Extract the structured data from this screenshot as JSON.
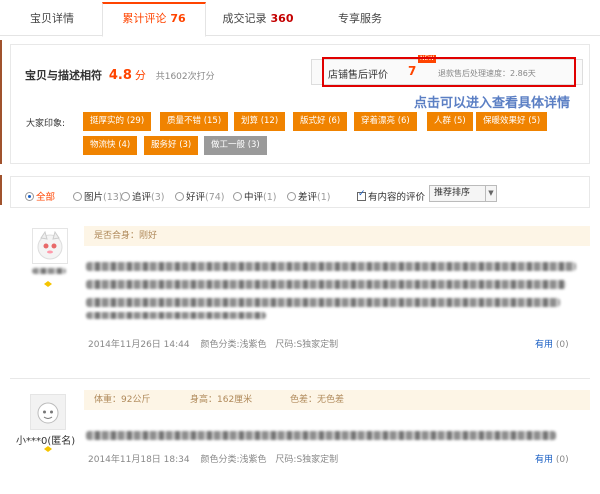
{
  "tabs": [
    {
      "label": "宝贝详情",
      "count": ""
    },
    {
      "label": "累计评论",
      "count": "76"
    },
    {
      "label": "成交记录",
      "count": "360"
    },
    {
      "label": "专享服务",
      "count": ""
    }
  ],
  "summary": {
    "match_label": "宝贝与描述相符",
    "match_score": "4.8",
    "match_unit": "分",
    "match_total": "共1602次打分",
    "after_sales_label": "店铺售后评价",
    "after_sales_value": "7",
    "after_sales_badge": "NEW",
    "after_sales_sub": "退款售后处理速度：2.86天",
    "hint": "点击可以进入查看具体详情",
    "impression_label": "大家印象:"
  },
  "tags": [
    "挺厚实的 (29)",
    "质量不错 (15)",
    "划算 (12)",
    "版式好 (6)",
    "穿着漂亮 (6)",
    "人群 (5)",
    "保暖效果好 (5)",
    "物流快 (4)",
    "服务好 (3)",
    "做工一般 (3)"
  ],
  "filter": {
    "all": "全部",
    "pics": "图片",
    "pics_count": "(13)",
    "append": "追评",
    "append_count": "(3)",
    "good": "好评",
    "good_count": "(74)",
    "mid": "中评",
    "mid_count": "(1)",
    "bad": "差评",
    "bad_count": "(1)",
    "has_content": "有内容的评价",
    "sort": "推荐排序"
  },
  "reviews": [
    {
      "user": "",
      "attr_fit": "是否合身：刚好",
      "date": "2014年11月26日 14:44",
      "color": "颜色分类:浅紫色",
      "size": "尺码:S独家定制",
      "useful_label": "有用",
      "useful_count": "(0)"
    },
    {
      "user": "小***0(匿名)",
      "attr_weight": "体重：92公斤",
      "attr_height": "身高：162厘米",
      "attr_color": "色差：无色差",
      "date": "2014年11月18日 18:34",
      "color": "颜色分类:浅紫色",
      "size": "尺码:S独家定制",
      "useful_label": "有用",
      "useful_count": "(0)"
    }
  ],
  "colors": {
    "accent": "#ff4400",
    "tag": "#f08300",
    "highlight": "#e00000",
    "hint": "#5b7fc4"
  }
}
